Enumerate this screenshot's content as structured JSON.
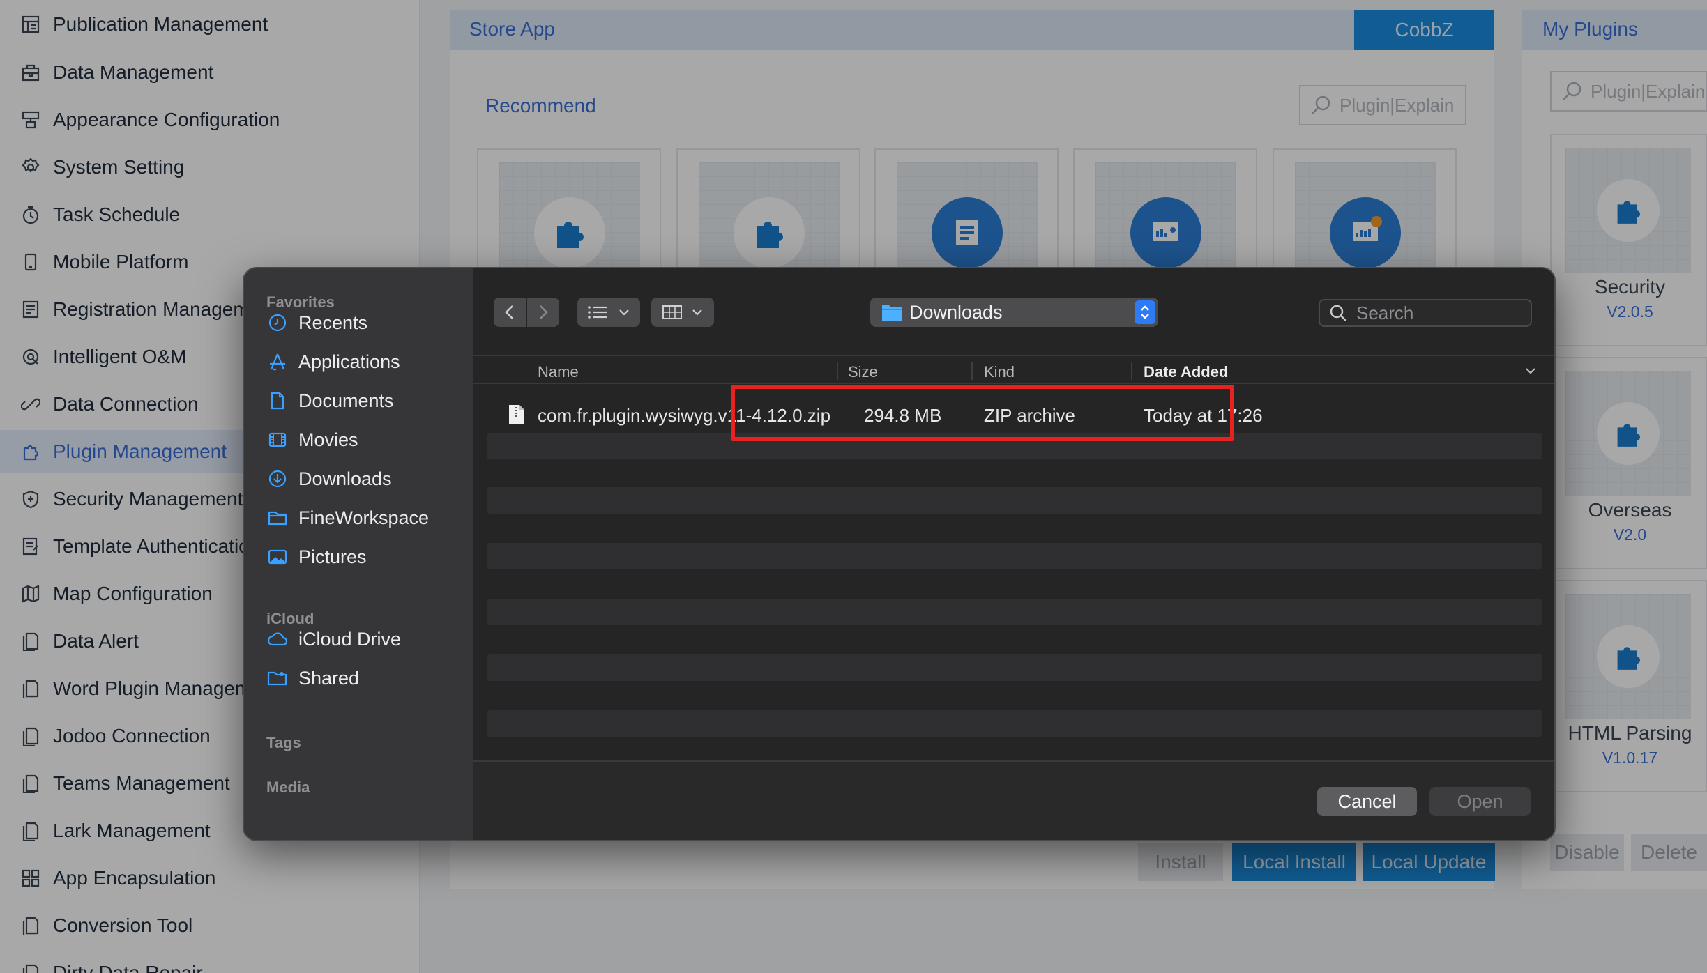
{
  "sidebar": {
    "items": [
      {
        "label": "Publication Management",
        "icon": "publication-icon"
      },
      {
        "label": "Data Management",
        "icon": "data-management-icon"
      },
      {
        "label": "Appearance Configuration",
        "icon": "appearance-icon"
      },
      {
        "label": "System Setting",
        "icon": "gear-icon"
      },
      {
        "label": "Task Schedule",
        "icon": "clock-icon"
      },
      {
        "label": "Mobile Platform",
        "icon": "mobile-icon"
      },
      {
        "label": "Registration Management",
        "icon": "registration-icon"
      },
      {
        "label": "Intelligent O&M",
        "icon": "om-icon"
      },
      {
        "label": "Data Connection",
        "icon": "link-icon"
      },
      {
        "label": "Plugin Management",
        "icon": "puzzle-icon",
        "active": true
      },
      {
        "label": "Security Management",
        "icon": "shield-icon"
      },
      {
        "label": "Template Authentication",
        "icon": "template-icon"
      },
      {
        "label": "Map Configuration",
        "icon": "map-icon"
      },
      {
        "label": "Data Alert",
        "icon": "alert-icon"
      },
      {
        "label": "Word Plugin Management",
        "icon": "word-icon"
      },
      {
        "label": "Jodoo Connection",
        "icon": "jodoo-icon"
      },
      {
        "label": "Teams Management",
        "icon": "teams-icon"
      },
      {
        "label": "Lark Management",
        "icon": "lark-icon"
      },
      {
        "label": "App Encapsulation",
        "icon": "apps-icon"
      },
      {
        "label": "Conversion Tool",
        "icon": "conversion-icon"
      },
      {
        "label": "Dirty Data Repair",
        "icon": "repair-icon"
      }
    ]
  },
  "store": {
    "title": "Store App",
    "account_button": "CobbZ",
    "section": "Recommend",
    "search_placeholder": "Plugin|Explain",
    "buttons": {
      "install": "Install",
      "local_install": "Local Install",
      "local_update": "Local Update"
    }
  },
  "my_plugins": {
    "title": "My Plugins",
    "search_placeholder": "Plugin|Explain",
    "cards": [
      {
        "name": "Security",
        "version": "V2.0.5"
      },
      {
        "name": "Overseas",
        "version": "V2.0"
      },
      {
        "name": "HTML Parsing",
        "version": "V1.0.17"
      }
    ],
    "buttons": {
      "disable": "Disable",
      "delete": "Delete"
    }
  },
  "dialog": {
    "favorites_header": "Favorites",
    "favorites": [
      {
        "label": "Recents",
        "icon": "clock-icon"
      },
      {
        "label": "Applications",
        "icon": "applications-icon"
      },
      {
        "label": "Documents",
        "icon": "document-icon"
      },
      {
        "label": "Movies",
        "icon": "film-icon"
      },
      {
        "label": "Downloads",
        "icon": "download-icon"
      },
      {
        "label": "FineWorkspace",
        "icon": "folder-icon"
      },
      {
        "label": "Pictures",
        "icon": "picture-icon"
      }
    ],
    "icloud_header": "iCloud",
    "icloud": [
      {
        "label": "iCloud Drive",
        "icon": "cloud-icon"
      },
      {
        "label": "Shared",
        "icon": "shared-folder-icon"
      }
    ],
    "tags_header": "Tags",
    "media_header": "Media",
    "location": "Downloads",
    "search_placeholder": "Search",
    "columns": {
      "name": "Name",
      "size": "Size",
      "kind": "Kind",
      "date_added": "Date Added"
    },
    "files": [
      {
        "name": "com.fr.plugin.wysiwyg.v11-4.12.0.zip",
        "size": "294.8 MB",
        "kind": "ZIP archive",
        "date_added": "Today at 17:26"
      }
    ],
    "cancel_label": "Cancel",
    "open_label": "Open"
  },
  "colors": {
    "accent": "#3a6fd8",
    "header_blue": "#1b8de0",
    "highlight_red": "#e8231f",
    "dialog_bg": "#252526",
    "dialog_sidebar": "#363537",
    "folder_blue": "#3aa0ff"
  }
}
